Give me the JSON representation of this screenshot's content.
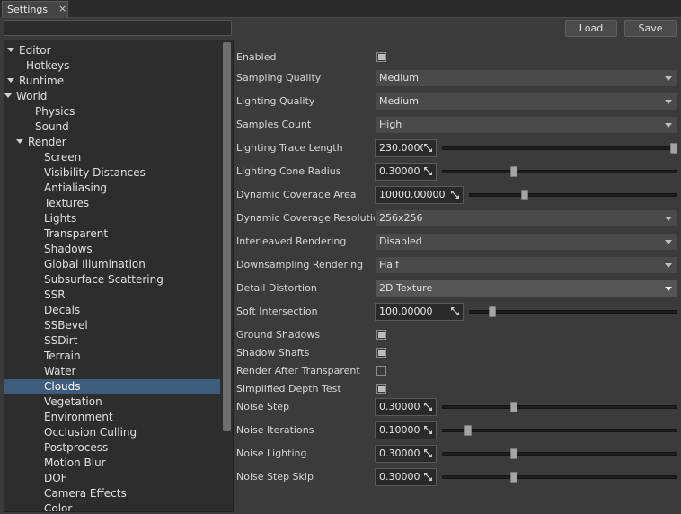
{
  "tab": {
    "label": "Settings",
    "close": "×"
  },
  "search": {
    "value": "",
    "placeholder": ""
  },
  "tree": [
    {
      "label": "Editor",
      "arrow": true,
      "indent": 0,
      "selected": false
    },
    {
      "label": "Hotkeys",
      "arrow": false,
      "indent": 1,
      "selected": false
    },
    {
      "label": "Runtime",
      "arrow": true,
      "indent": 0,
      "selected": false
    },
    {
      "label": "World",
      "arrow": true,
      "indent": 1,
      "selected": false
    },
    {
      "label": "Physics",
      "arrow": false,
      "indent": 2,
      "selected": false
    },
    {
      "label": "Sound",
      "arrow": false,
      "indent": 2,
      "selected": false
    },
    {
      "label": "Render",
      "arrow": true,
      "indent": 2,
      "selected": false
    },
    {
      "label": "Screen",
      "arrow": false,
      "indent": 3,
      "selected": false
    },
    {
      "label": "Visibility Distances",
      "arrow": false,
      "indent": 3,
      "selected": false
    },
    {
      "label": "Antialiasing",
      "arrow": false,
      "indent": 3,
      "selected": false
    },
    {
      "label": "Textures",
      "arrow": false,
      "indent": 3,
      "selected": false
    },
    {
      "label": "Lights",
      "arrow": false,
      "indent": 3,
      "selected": false
    },
    {
      "label": "Transparent",
      "arrow": false,
      "indent": 3,
      "selected": false
    },
    {
      "label": "Shadows",
      "arrow": false,
      "indent": 3,
      "selected": false
    },
    {
      "label": "Global Illumination",
      "arrow": false,
      "indent": 3,
      "selected": false
    },
    {
      "label": "Subsurface Scattering",
      "arrow": false,
      "indent": 3,
      "selected": false
    },
    {
      "label": "SSR",
      "arrow": false,
      "indent": 3,
      "selected": false
    },
    {
      "label": "Decals",
      "arrow": false,
      "indent": 3,
      "selected": false
    },
    {
      "label": "SSBevel",
      "arrow": false,
      "indent": 3,
      "selected": false
    },
    {
      "label": "SSDirt",
      "arrow": false,
      "indent": 3,
      "selected": false
    },
    {
      "label": "Terrain",
      "arrow": false,
      "indent": 3,
      "selected": false
    },
    {
      "label": "Water",
      "arrow": false,
      "indent": 3,
      "selected": false
    },
    {
      "label": "Clouds",
      "arrow": false,
      "indent": 3,
      "selected": true
    },
    {
      "label": "Vegetation",
      "arrow": false,
      "indent": 3,
      "selected": false
    },
    {
      "label": "Environment",
      "arrow": false,
      "indent": 3,
      "selected": false
    },
    {
      "label": "Occlusion Culling",
      "arrow": false,
      "indent": 3,
      "selected": false
    },
    {
      "label": "Postprocess",
      "arrow": false,
      "indent": 3,
      "selected": false
    },
    {
      "label": "Motion Blur",
      "arrow": false,
      "indent": 3,
      "selected": false
    },
    {
      "label": "DOF",
      "arrow": false,
      "indent": 3,
      "selected": false
    },
    {
      "label": "Camera Effects",
      "arrow": false,
      "indent": 3,
      "selected": false
    },
    {
      "label": "Color",
      "arrow": false,
      "indent": 3,
      "selected": false
    }
  ],
  "buttons": {
    "load": "Load",
    "save": "Save"
  },
  "settings": [
    {
      "label": "Enabled",
      "type": "checkbox",
      "checked": true
    },
    {
      "label": "Sampling Quality",
      "type": "dropdown",
      "value": "Medium"
    },
    {
      "label": "Lighting Quality",
      "type": "dropdown",
      "value": "Medium"
    },
    {
      "label": "Samples Count",
      "type": "dropdown",
      "value": "High"
    },
    {
      "label": "Lighting Trace Length",
      "type": "slider",
      "value": "230.0000",
      "level": 1.0
    },
    {
      "label": "Lighting Cone Radius",
      "type": "slider",
      "value": "0.30000",
      "level": 0.3
    },
    {
      "label": "Dynamic Coverage Area",
      "type": "slider",
      "value": "10000.00000",
      "level": 0.26,
      "wide": true
    },
    {
      "label": "Dynamic Coverage Resolution",
      "type": "dropdown",
      "value": "256x256"
    },
    {
      "label": "Interleaved Rendering",
      "type": "dropdown",
      "value": "Disabled"
    },
    {
      "label": "Downsampling Rendering",
      "type": "dropdown",
      "value": "Half"
    },
    {
      "label": "Detail Distortion",
      "type": "dropdown",
      "value": "2D Texture",
      "active": true
    },
    {
      "label": "Soft Intersection",
      "type": "slider",
      "value": "100.00000",
      "level": 0.1,
      "wide": true
    },
    {
      "label": "Ground Shadows",
      "type": "checkbox",
      "checked": true
    },
    {
      "label": "Shadow Shafts",
      "type": "checkbox",
      "checked": true
    },
    {
      "label": "Render After Transparent",
      "type": "checkbox",
      "checked": false
    },
    {
      "label": "Simplified Depth Test",
      "type": "checkbox",
      "checked": true
    },
    {
      "label": "Noise Step",
      "type": "slider",
      "value": "0.30000",
      "level": 0.3
    },
    {
      "label": "Noise Iterations",
      "type": "slider",
      "value": "0.10000",
      "level": 0.1
    },
    {
      "label": "Noise Lighting",
      "type": "slider",
      "value": "0.30000",
      "level": 0.3
    },
    {
      "label": "Noise Step Skip",
      "type": "slider",
      "value": "0.30000",
      "level": 0.3
    }
  ]
}
